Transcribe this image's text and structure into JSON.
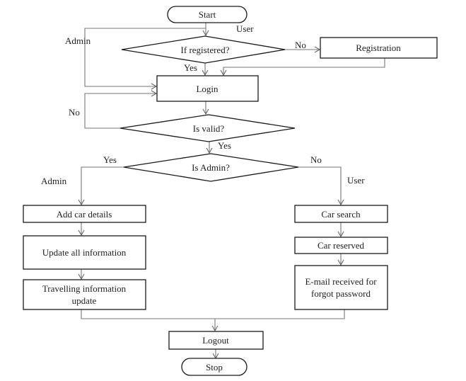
{
  "diagram": {
    "type": "flowchart",
    "nodes": {
      "start": "Start",
      "if_registered": "If registered?",
      "registration": "Registration",
      "login": "Login",
      "is_valid": "Is valid?",
      "is_admin": "Is Admin?",
      "add_car": "Add car details",
      "update_all": "Update all information",
      "travel_1": "Travelling information",
      "travel_2": "update",
      "car_search": "Car search",
      "car_reserved": "Car reserved",
      "email_1": "E-mail received for",
      "email_2": "forgot password",
      "logout": "Logout",
      "stop": "Stop"
    },
    "edge_labels": {
      "user_top": "User",
      "admin_top": "Admin",
      "no_register": "No",
      "yes_register": "Yes",
      "no_valid": "No",
      "yes_valid": "Yes",
      "yes_admin": "Yes",
      "no_admin": "No",
      "admin_branch": "Admin",
      "user_branch": "User"
    }
  }
}
